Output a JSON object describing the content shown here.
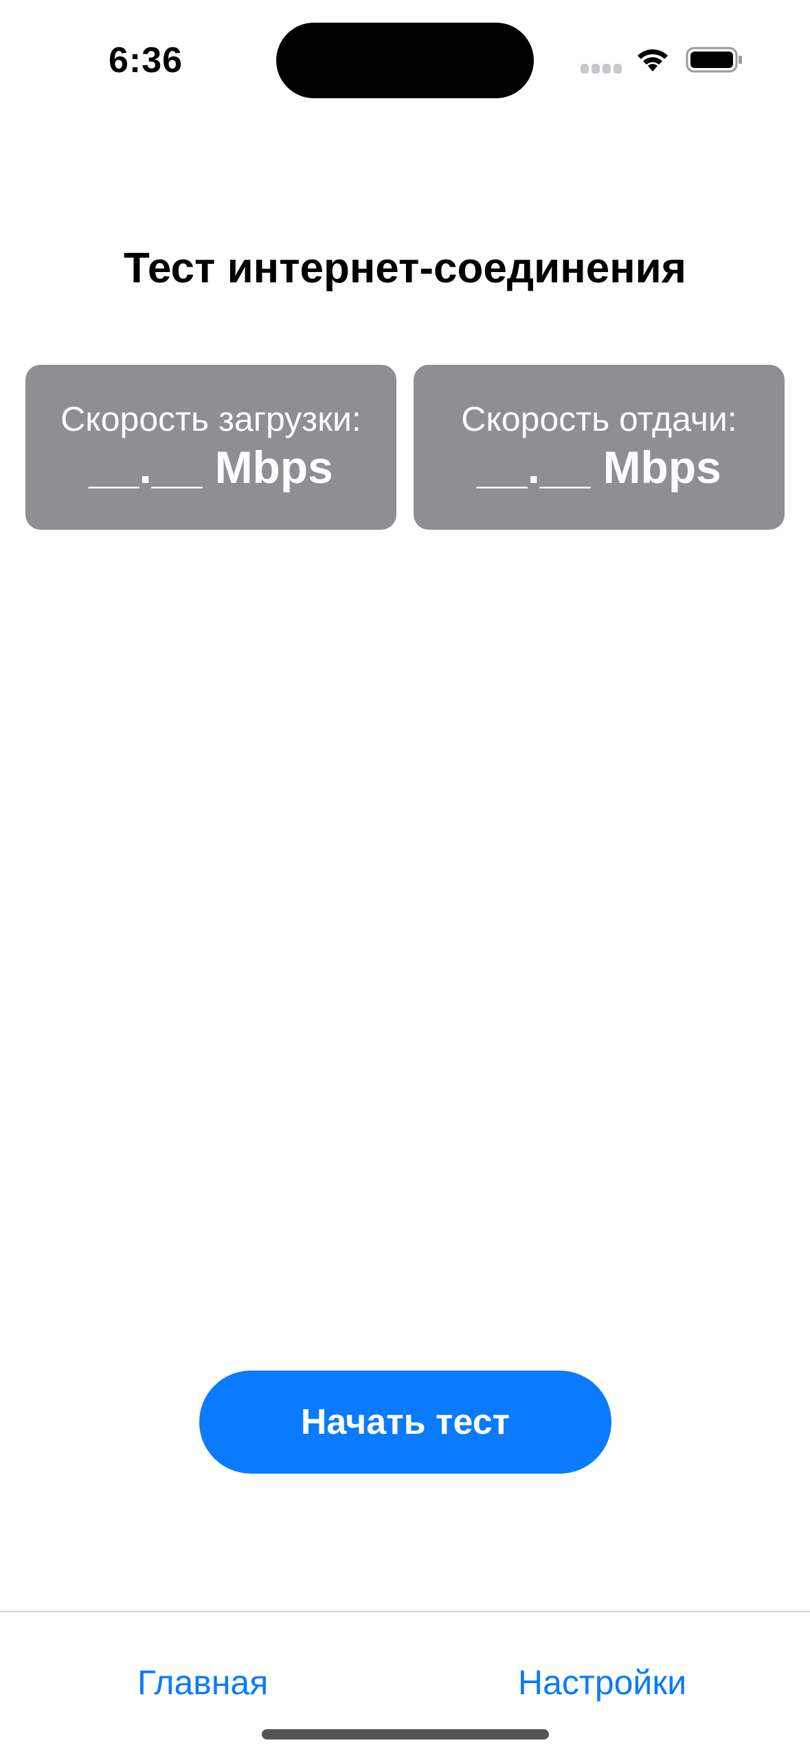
{
  "status_bar": {
    "time": "6:36"
  },
  "title": "Тест интернет-соединения",
  "cards": {
    "download": {
      "label": "Скорость загрузки:",
      "value": "__.__ Mbps"
    },
    "upload": {
      "label": "Скорость отдачи:",
      "value": "__.__ Mbps"
    }
  },
  "start_button": {
    "label": "Начать тест"
  },
  "tab_bar": {
    "home_label": "Главная",
    "settings_label": "Настройки"
  },
  "colors": {
    "accent": "#0a7aff",
    "card_background": "#8e8e93"
  }
}
